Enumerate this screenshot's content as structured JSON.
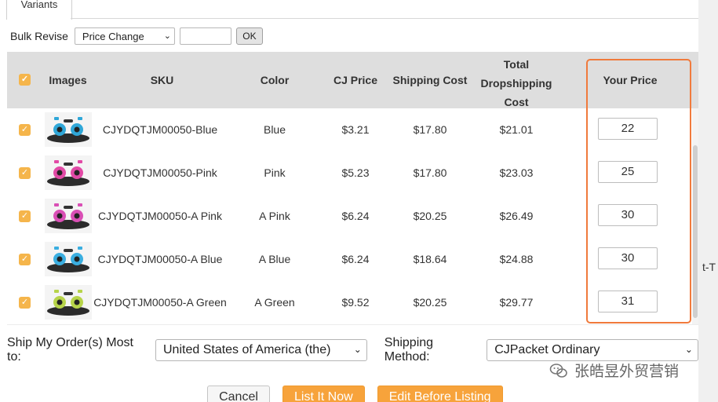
{
  "tab": {
    "label": "Variants"
  },
  "bulk": {
    "label": "Bulk Revise",
    "select_value": "Price Change",
    "ok_label": "OK"
  },
  "table": {
    "headers": {
      "images": "Images",
      "sku": "SKU",
      "color": "Color",
      "cj_price": "CJ Price",
      "shipping_cost": "Shipping Cost",
      "total_line1": "Total",
      "total_line2": "Dropshipping",
      "total_line3": "Cost",
      "your_price": "Your Price"
    },
    "rows": [
      {
        "sku": "CJYDQTJM00050-Blue",
        "color": "Blue",
        "cj_price": "$3.21",
        "shipping": "$17.80",
        "total": "$21.01",
        "your_price": "22",
        "accent": "#2fa7d8"
      },
      {
        "sku": "CJYDQTJM00050-Pink",
        "color": "Pink",
        "cj_price": "$5.23",
        "shipping": "$17.80",
        "total": "$23.03",
        "your_price": "25",
        "accent": "#e24aa6"
      },
      {
        "sku": "CJYDQTJM00050-A Pink",
        "color": "A Pink",
        "cj_price": "$6.24",
        "shipping": "$20.25",
        "total": "$26.49",
        "your_price": "30",
        "accent": "#d94fb5"
      },
      {
        "sku": "CJYDQTJM00050-A Blue",
        "color": "A Blue",
        "cj_price": "$6.24",
        "shipping": "$18.64",
        "total": "$24.88",
        "your_price": "30",
        "accent": "#3aaee0"
      },
      {
        "sku": "CJYDQTJM00050-A Green",
        "color": "A Green",
        "cj_price": "$9.52",
        "shipping": "$20.25",
        "total": "$29.77",
        "your_price": "31",
        "accent": "#b7d44a"
      }
    ]
  },
  "shipping": {
    "destination_label": "Ship My Order(s) Most to:",
    "destination_value": "United States of America (the)",
    "method_label": "Shipping Method:",
    "method_value": "CJPacket Ordinary"
  },
  "buttons": {
    "cancel": "Cancel",
    "list_now": "List It Now",
    "edit_before": "Edit Before Listing"
  },
  "side_text": "t-T",
  "watermark": "张皓昱外贸营销",
  "colors": {
    "checkbox": "#f5b54b",
    "highlight": "#f07a3c",
    "button_orange": "#f7a33b",
    "header_bg": "#dedede"
  }
}
